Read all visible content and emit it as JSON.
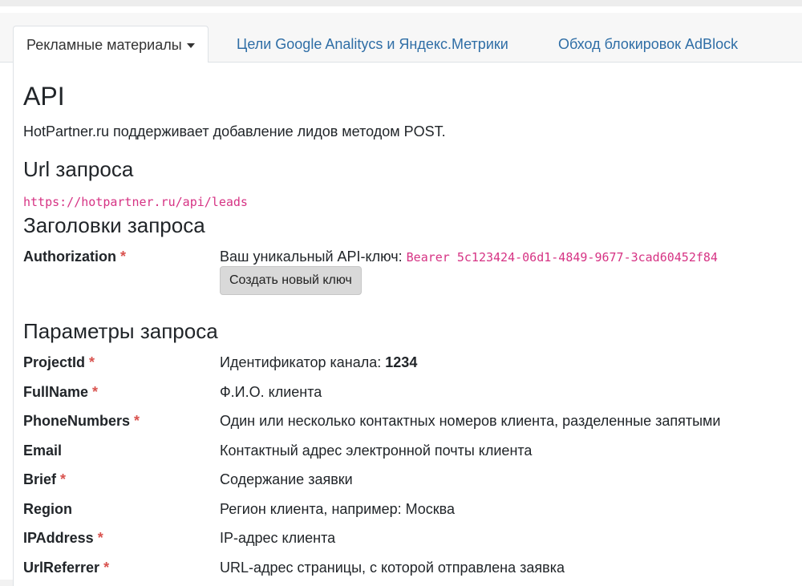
{
  "tabs": [
    {
      "label": "Рекламные материалы",
      "active": true
    },
    {
      "label": "Цели Google Analitycs и Яндекс.Метрики",
      "active": false
    },
    {
      "label": "Обход блокировок AdBlock",
      "active": false
    }
  ],
  "api": {
    "title": "API",
    "intro": "HotPartner.ru поддерживает добавление лидов методом POST.",
    "url_heading": "Url запроса",
    "url": "https://hotpartner.ru/api/leads",
    "headers_heading": "Заголовки запроса",
    "auth_name": "Authorization",
    "auth_desc_prefix": "Ваш уникальный API-ключ:",
    "auth_key": "Bearer 5c123424-06d1-4849-9677-3cad60452f84",
    "new_key_button": "Создать новый ключ",
    "params_heading": "Параметры запроса",
    "required_mark": "*"
  },
  "params": [
    {
      "name": "ProjectId",
      "required": true,
      "desc": "Идентификатор канала:",
      "value": "1234"
    },
    {
      "name": "FullName",
      "required": true,
      "desc": "Ф.И.О. клиента",
      "value": ""
    },
    {
      "name": "PhoneNumbers",
      "required": true,
      "desc": "Один или несколько контактных номеров клиента, разделенные запятыми",
      "value": ""
    },
    {
      "name": "Email",
      "required": false,
      "desc": "Контактный адрес электронной почты клиента",
      "value": ""
    },
    {
      "name": "Brief",
      "required": true,
      "desc": "Содержание заявки",
      "value": ""
    },
    {
      "name": "Region",
      "required": false,
      "desc": "Регион клиента, например: Москва",
      "value": ""
    },
    {
      "name": "IPAddress",
      "required": true,
      "desc": "IP-адрес клиента",
      "value": ""
    },
    {
      "name": "UrlReferrer",
      "required": true,
      "desc": "URL-адрес страницы, с которой отправлена заявка",
      "value": ""
    }
  ]
}
